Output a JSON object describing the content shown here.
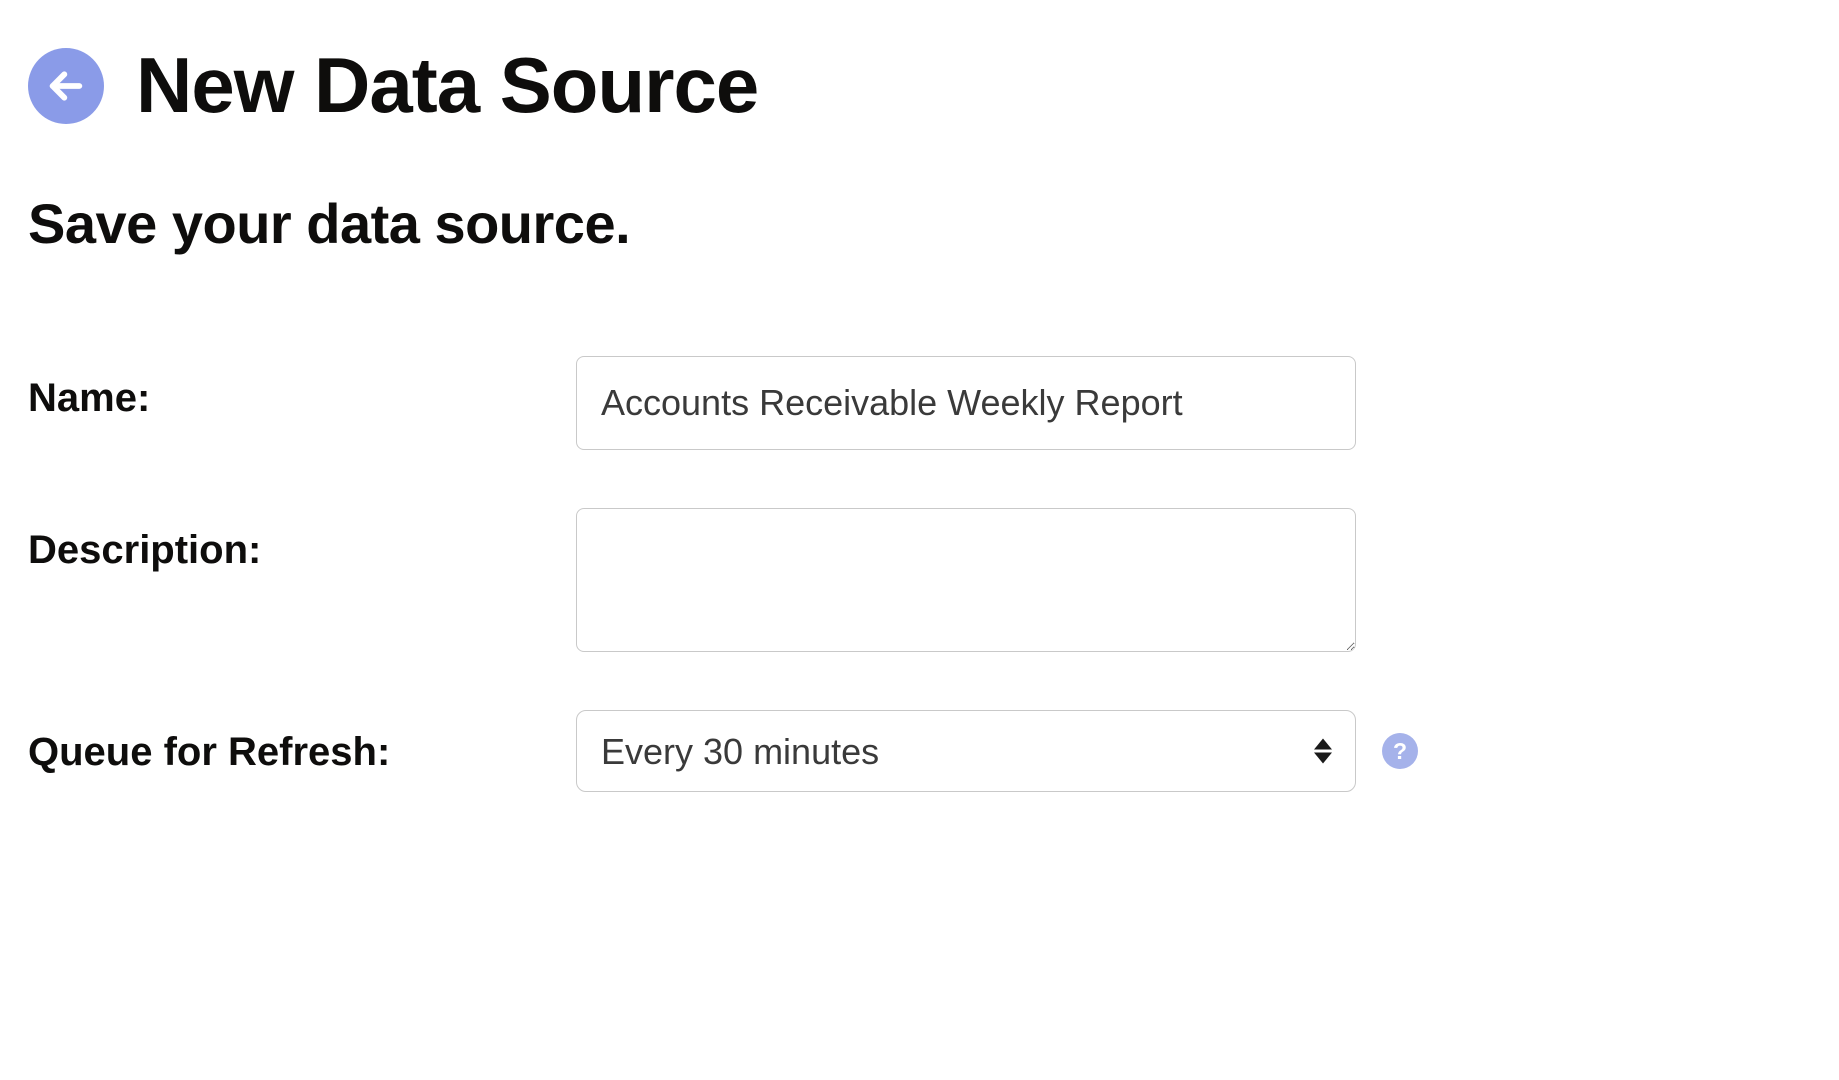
{
  "header": {
    "title": "New Data Source"
  },
  "subtitle": "Save your data source.",
  "form": {
    "name": {
      "label": "Name:",
      "value": "Accounts Receivable Weekly Report"
    },
    "description": {
      "label": "Description:",
      "value": ""
    },
    "refresh": {
      "label": "Queue for Refresh:",
      "selected": "Every 30 minutes"
    }
  },
  "help": {
    "glyph": "?"
  }
}
